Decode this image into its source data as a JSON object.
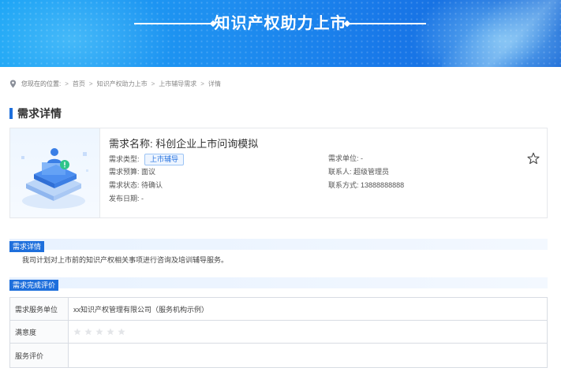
{
  "banner": {
    "title": "知识产权助力上市"
  },
  "breadcrumb": {
    "prefix": "您现在的位置:",
    "separator": ">",
    "items": [
      "首页",
      "知识产权助力上市",
      "上市辅导需求",
      "详情"
    ]
  },
  "section": {
    "title": "需求详情"
  },
  "demand": {
    "name_label": "需求名称:",
    "name_value": "科创企业上市问询模拟",
    "type_label": "需求类型:",
    "type_value": "上市辅导",
    "budget_label": "需求预算:",
    "budget_value": "面议",
    "status_label": "需求状态:",
    "status_value": "待确认",
    "date_label": "发布日期:",
    "date_value": "-",
    "unit_label": "需求单位:",
    "unit_value": "-",
    "contact_label": "联系人:",
    "contact_value": "超级管理员",
    "phone_label": "联系方式:",
    "phone_value": "13888888888"
  },
  "detail": {
    "title": "需求详情",
    "text": "我司计划对上市前的知识产权相关事项进行咨询及培训辅导服务。"
  },
  "evaluation": {
    "title": "需求完成评价",
    "rows": [
      {
        "label": "需求服务单位",
        "value": "xx知识产权管理有限公司（服务机构示例）"
      },
      {
        "label": "满意度",
        "stars": 0,
        "max": 5
      },
      {
        "label": "服务评价",
        "value": ""
      }
    ]
  },
  "colors": {
    "accent": "#1e6fdc",
    "banner": "#1a8ef0"
  }
}
